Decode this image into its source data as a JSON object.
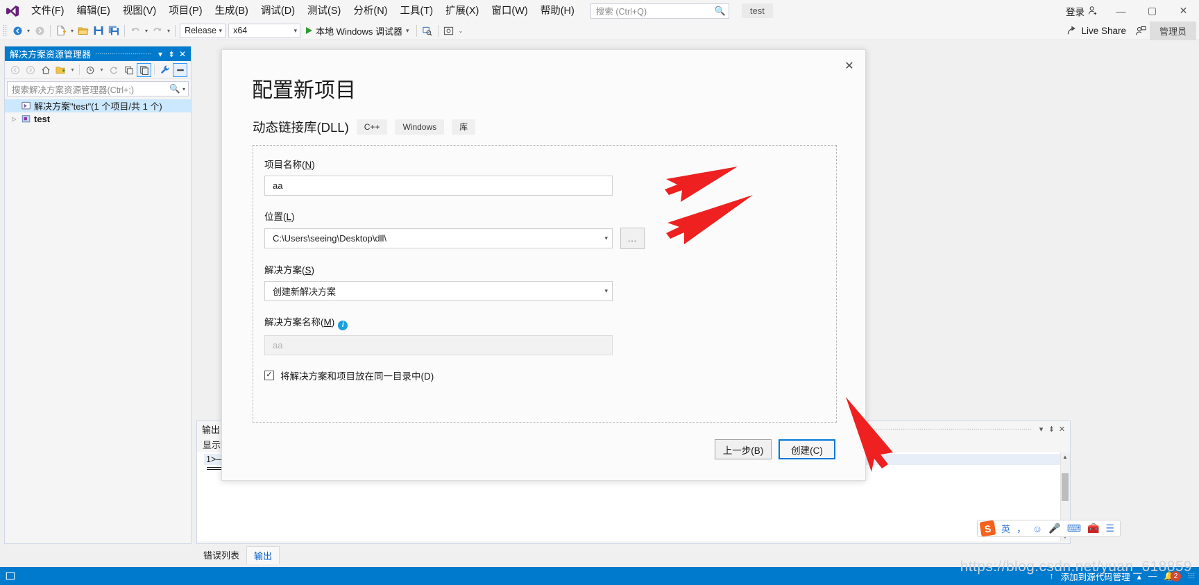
{
  "menubar": {
    "logo_name": "visual-studio-logo",
    "items": [
      {
        "label": "文件(F)"
      },
      {
        "label": "编辑(E)"
      },
      {
        "label": "视图(V)"
      },
      {
        "label": "项目(P)"
      },
      {
        "label": "生成(B)"
      },
      {
        "label": "调试(D)"
      },
      {
        "label": "测试(S)"
      },
      {
        "label": "分析(N)"
      },
      {
        "label": "工具(T)"
      },
      {
        "label": "扩展(X)"
      },
      {
        "label": "窗口(W)"
      },
      {
        "label": "帮助(H)"
      }
    ],
    "search_placeholder": "搜索 (Ctrl+Q)",
    "project_chip": "test",
    "signin_label": "登录",
    "minimize": "—",
    "maximize": "▢",
    "close": "✕"
  },
  "toolbar": {
    "config_value": "Release",
    "platform_value": "x64",
    "run_label": "本地 Windows 调试器",
    "live_share_label": "Live Share",
    "admin_label": "管理员"
  },
  "solution_explorer": {
    "title": "解决方案资源管理器",
    "search_placeholder": "搜索解决方案资源管理器(Ctrl+;)",
    "solution_node": "解决方案\"test\"(1 个项目/共 1 个)",
    "project_node": "test"
  },
  "output_pane": {
    "title": "输出",
    "show_label": "显示输",
    "line1": "1>——"
  },
  "bottom_tabs": [
    {
      "label": "错误列表",
      "active": false
    },
    {
      "label": "输出",
      "active": true
    }
  ],
  "statusbar": {
    "source_control": "添加到源代码管理",
    "notify_count": "2"
  },
  "ime": {
    "lang": "英",
    "punct": "，"
  },
  "watermark": "https://blog.csdn.net/yuan_618859",
  "dialog": {
    "title": "配置新项目",
    "subtitle": "动态链接库(DLL)",
    "tags": [
      "C++",
      "Windows",
      "库"
    ],
    "close_label": "✕",
    "project_name": {
      "label_text": "项目名称(",
      "label_key": "N",
      "label_end": ")",
      "value": "aa"
    },
    "location": {
      "label_text": "位置(",
      "label_key": "L",
      "label_end": ")",
      "value": "C:\\Users\\seeing\\Desktop\\dll\\",
      "browse_label": "..."
    },
    "solution": {
      "label_text": "解决方案(",
      "label_key": "S",
      "label_end": ")",
      "value": "创建新解决方案"
    },
    "solution_name": {
      "label_text": "解决方案名称(",
      "label_key": "M",
      "label_end": ")",
      "placeholder": "aa",
      "info_glyph": "i"
    },
    "checkbox": {
      "label": "将解决方案和项目放在同一目录中(D)",
      "checked": true,
      "check_glyph": "✓"
    },
    "back_button": "上一步(B)",
    "create_button": "创建(C)"
  },
  "colors": {
    "accent": "#007acc",
    "primary_border": "#0078d7",
    "arrow_red": "#ee2020",
    "title_bar": "#007acc"
  }
}
